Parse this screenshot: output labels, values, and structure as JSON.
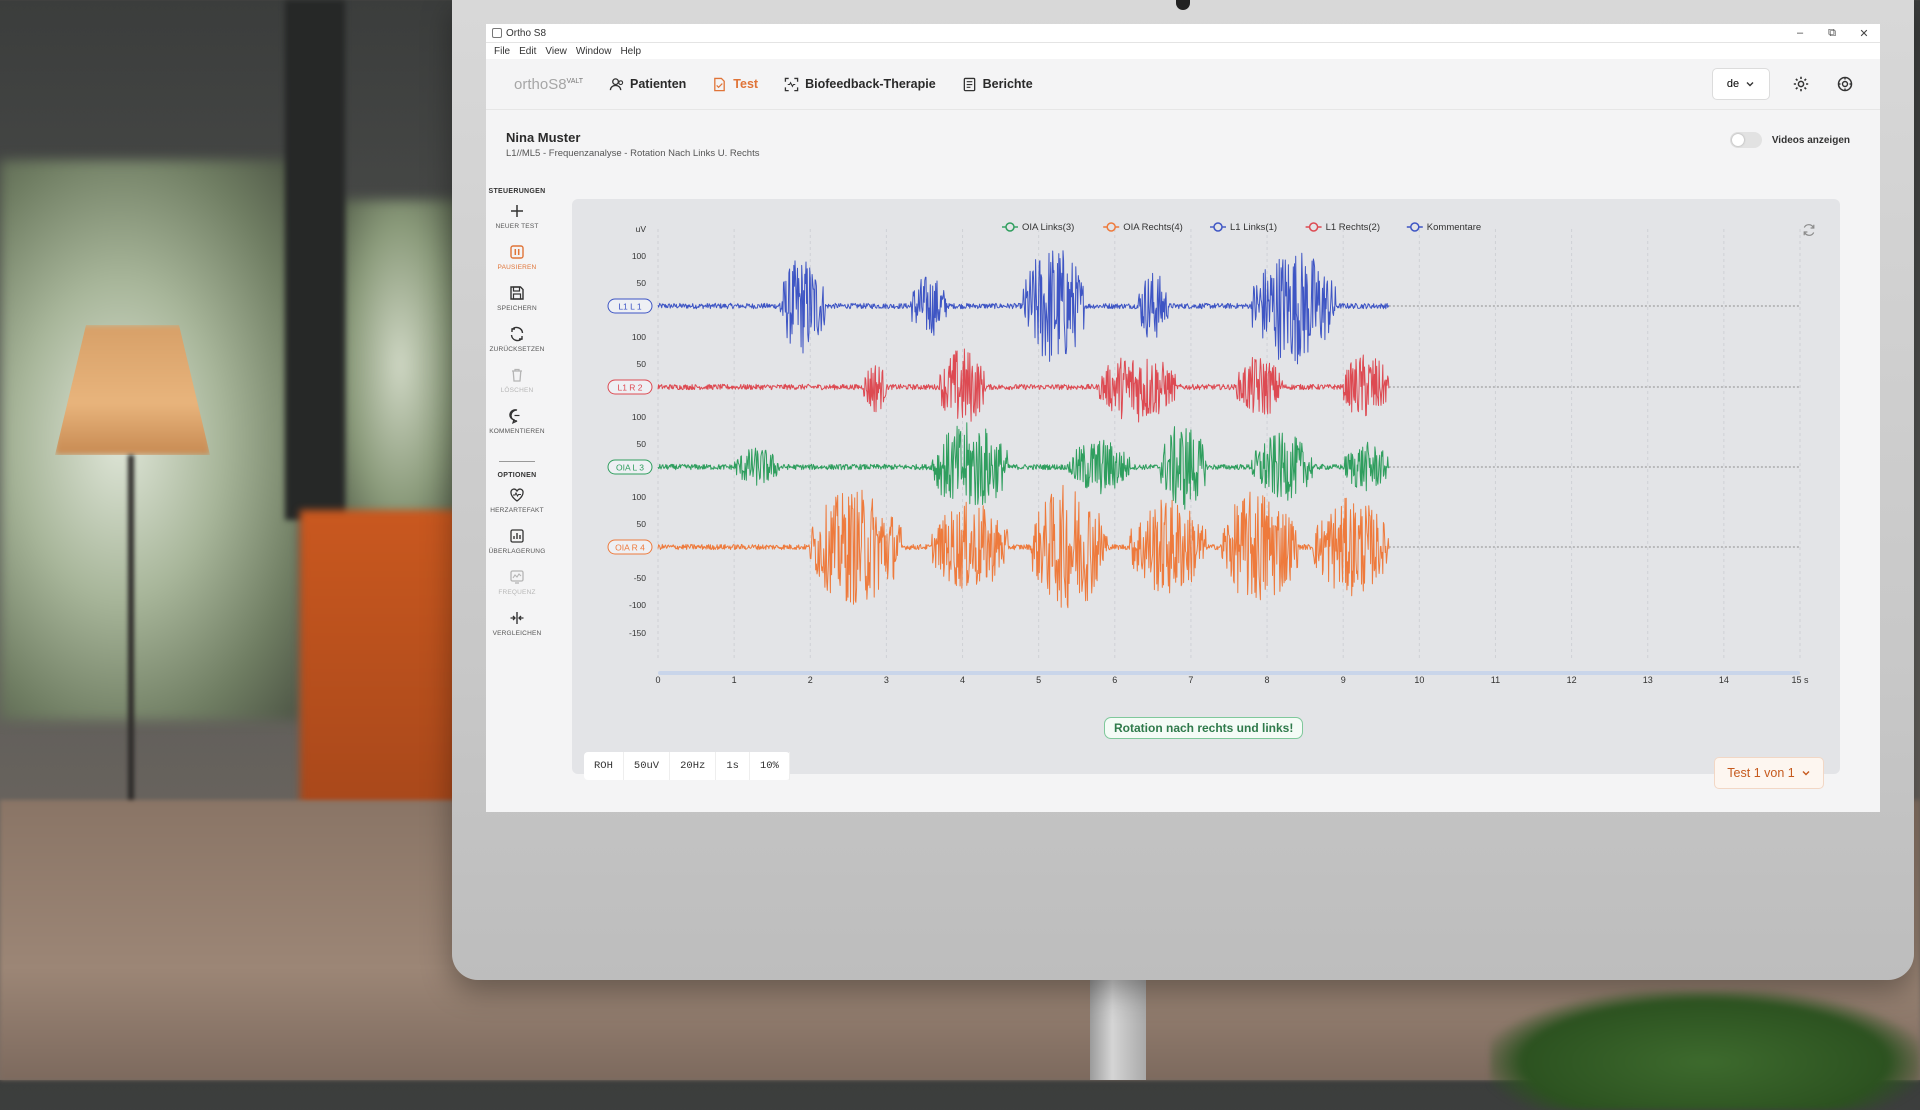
{
  "window": {
    "title": "Ortho S8",
    "menu": [
      "File",
      "Edit",
      "View",
      "Window",
      "Help"
    ]
  },
  "navbar": {
    "logo": "orthoS8",
    "logo_sup": "VALT",
    "items": [
      {
        "label": "Patienten",
        "icon": "user-icon",
        "active": false
      },
      {
        "label": "Test",
        "icon": "document-icon",
        "active": true
      },
      {
        "label": "Biofeedback-Therapie",
        "icon": "scan-icon",
        "active": false
      },
      {
        "label": "Berichte",
        "icon": "report-icon",
        "active": false
      }
    ],
    "language": "de"
  },
  "patient": {
    "name": "Nina Muster",
    "subtitle": "L1//ML5 - Frequenzanalyse - Rotation Nach Links U. Rechts"
  },
  "video_toggle": {
    "label": "Videos anzeigen",
    "on": false
  },
  "sidebar": {
    "controls_title": "STEUERUNGEN",
    "controls": [
      {
        "label": "Neuer Test",
        "icon": "plus-icon",
        "state": "normal"
      },
      {
        "label": "Pausieren",
        "icon": "pause-icon",
        "state": "active"
      },
      {
        "label": "Speichern",
        "icon": "save-icon",
        "state": "normal"
      },
      {
        "label": "Zurücksetzen",
        "icon": "reset-icon",
        "state": "normal"
      },
      {
        "label": "Löschen",
        "icon": "trash-icon",
        "state": "disabled"
      },
      {
        "label": "Kommentieren",
        "icon": "comment-icon",
        "state": "normal"
      }
    ],
    "options_title": "OPTIONEN",
    "options": [
      {
        "label": "Herzartefakt",
        "icon": "heart-icon",
        "state": "normal"
      },
      {
        "label": "Überlagerung",
        "icon": "overlay-chart-icon",
        "state": "normal"
      },
      {
        "label": "Frequenz",
        "icon": "frequency-icon",
        "state": "disabled"
      },
      {
        "label": "Vergleichen",
        "icon": "compare-icon",
        "state": "normal"
      }
    ]
  },
  "chart_data": {
    "type": "line",
    "legend": [
      {
        "name": "OIA Links(3)",
        "color": "#2f9e5e"
      },
      {
        "name": "OIA Rechts(4)",
        "color": "#ee7a3c"
      },
      {
        "name": "L1 Links(1)",
        "color": "#3e55c4"
      },
      {
        "name": "L1 Rechts(2)",
        "color": "#dd4a52"
      },
      {
        "name": "Kommentare",
        "color": "#3e55c4"
      }
    ],
    "y_unit": "uV",
    "y_ticks": [
      "100",
      "50",
      "100",
      "50",
      "100",
      "50",
      "100",
      "50",
      "-50",
      "-100",
      "-150"
    ],
    "x_ticks": [
      "0",
      "1",
      "2",
      "3",
      "4",
      "5",
      "6",
      "7",
      "8",
      "9",
      "10",
      "11",
      "12",
      "13",
      "14",
      "15 s"
    ],
    "xlim": [
      0,
      15
    ],
    "recorded_until_s": 9.6,
    "channels": [
      {
        "tag": "L1 L 1",
        "color": "#3e55c4",
        "bursts": [
          [
            1.6,
            2.2,
            55
          ],
          [
            3.3,
            3.8,
            35
          ],
          [
            4.8,
            5.6,
            70
          ],
          [
            6.3,
            6.7,
            40
          ],
          [
            7.8,
            8.9,
            65
          ]
        ]
      },
      {
        "tag": "L1 R 2",
        "color": "#dd4a52",
        "bursts": [
          [
            2.7,
            3.0,
            30
          ],
          [
            3.7,
            4.3,
            45
          ],
          [
            5.8,
            6.8,
            40
          ],
          [
            7.6,
            8.2,
            35
          ],
          [
            9.0,
            9.6,
            38
          ]
        ]
      },
      {
        "tag": "OIA L 3",
        "color": "#2f9e5e",
        "bursts": [
          [
            1.0,
            1.6,
            22
          ],
          [
            3.6,
            4.6,
            50
          ],
          [
            5.4,
            6.2,
            32
          ],
          [
            6.6,
            7.2,
            50
          ],
          [
            7.8,
            8.6,
            38
          ],
          [
            9.0,
            9.6,
            28
          ]
        ]
      },
      {
        "tag": "OIA R 4",
        "color": "#ee7a3c",
        "bursts": [
          [
            2.0,
            3.2,
            65
          ],
          [
            3.6,
            4.6,
            50
          ],
          [
            4.9,
            5.9,
            70
          ],
          [
            6.2,
            7.2,
            55
          ],
          [
            7.4,
            8.4,
            65
          ],
          [
            8.6,
            9.6,
            55
          ]
        ]
      }
    ],
    "comment": "Rotation nach rechts und links!"
  },
  "bottom_buttons": [
    "ROH",
    "50uV",
    "20Hz",
    "1s",
    "10%"
  ],
  "test_select": "Test 1 von 1"
}
